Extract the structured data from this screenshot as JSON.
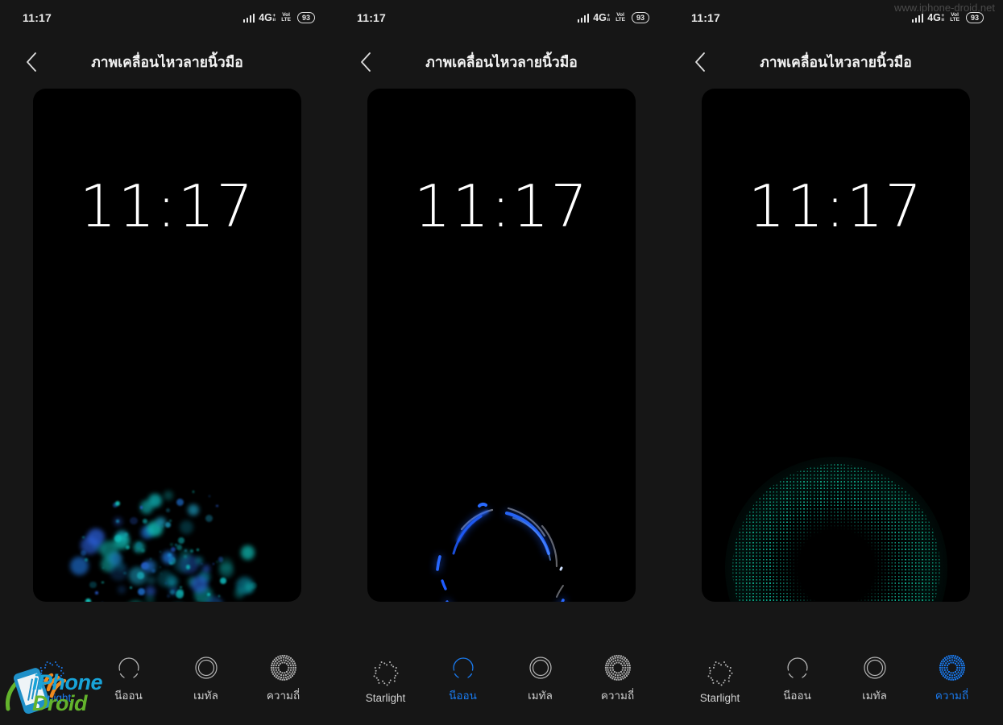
{
  "watermarks": {
    "url": "www.iphone-droid.net",
    "logo_line1": "iPhone",
    "logo_line2": "Droid"
  },
  "status_bar": {
    "time": "11:17",
    "network_type": "4G",
    "network_plus": "+",
    "network_sub": "ıı",
    "volte_top": "VoI",
    "volte_bottom": "LTE",
    "battery": "93",
    "signal_icon": "signal-bars-icon"
  },
  "header": {
    "back_icon": "chevron-left-icon",
    "title": "ภาพเคลื่อนไหวลายนิ้วมือ"
  },
  "preview": {
    "clock": "11:17"
  },
  "tabs": [
    {
      "id": "starlight",
      "label": "Starlight",
      "icon": "dotted-ring-icon"
    },
    {
      "id": "neon",
      "label": "นีออน",
      "icon": "arc-ring-icon"
    },
    {
      "id": "metal",
      "label": "เมทัล",
      "icon": "double-circle-icon"
    },
    {
      "id": "frequency",
      "label": "ความถี่",
      "icon": "concentric-dotted-ring-icon"
    }
  ],
  "panels": [
    {
      "id": "panel-starlight",
      "selected_tab": 0,
      "effect": "starlight-bokeh"
    },
    {
      "id": "panel-neon",
      "selected_tab": 1,
      "effect": "neon-arcs"
    },
    {
      "id": "panel-frequency",
      "selected_tab": 3,
      "effect": "frequency-dotted-ring"
    }
  ],
  "colors": {
    "accent": "#1a7bf0",
    "background": "#161616",
    "preview_background": "#000000",
    "text_primary": "#f2f2f2",
    "text_secondary": "#cfcfcf",
    "starlight": "#18c5c0",
    "neon": "#1f5cff",
    "frequency": "#12c8a8"
  }
}
